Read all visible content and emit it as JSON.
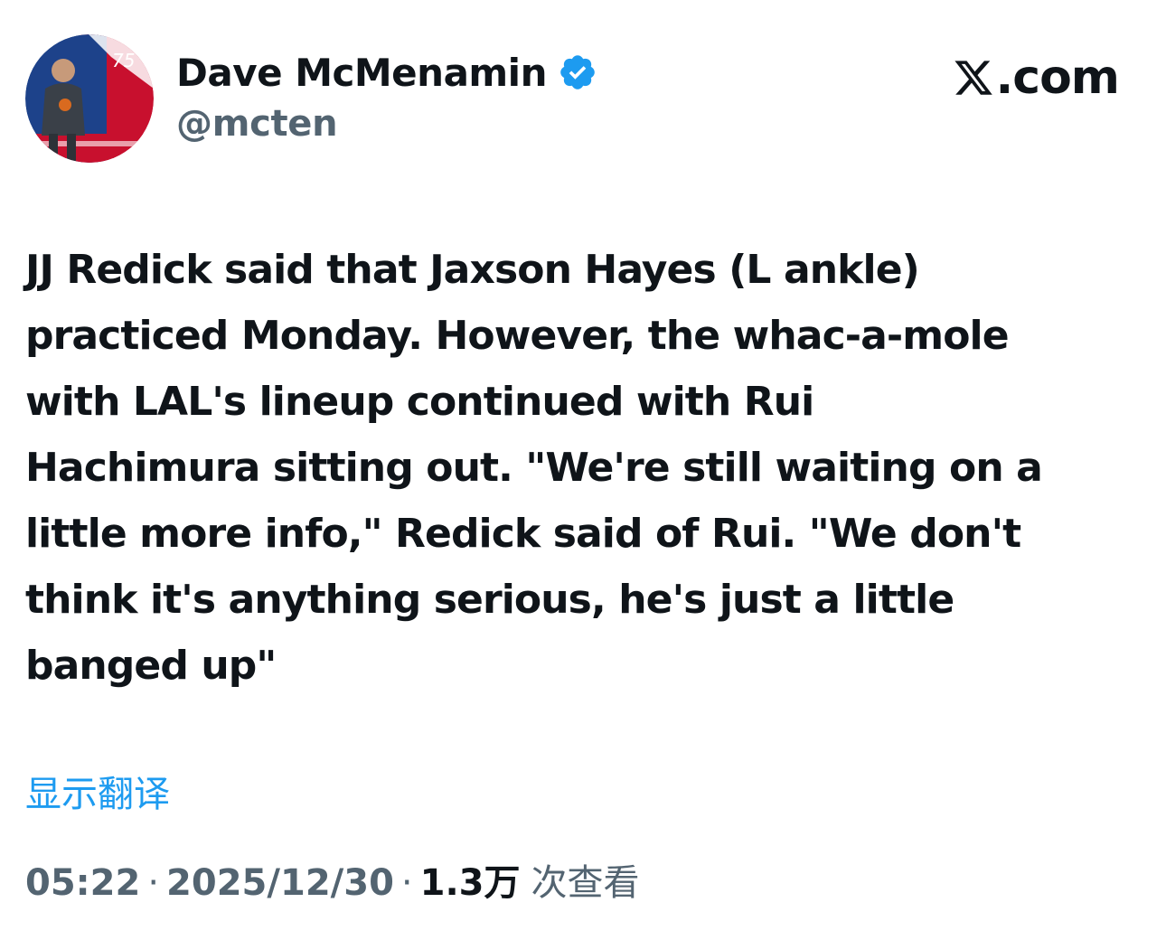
{
  "header": {
    "display_name": "Dave McMenamin",
    "handle": "@mcten",
    "verified": true,
    "verified_icon": "verified-badge-icon",
    "avatar_icon": "avatar"
  },
  "brand": {
    "logo_icon": "x-logo-icon",
    "text": ".com"
  },
  "tweet": {
    "text": "JJ Redick said that Jaxson Hayes (L ankle)\npracticed Monday. However, the whac-a-mole\nwith LAL's lineup continued with Rui\nHachimura sitting out. \"We're still waiting on a\nlittle more info,\" Redick said of Rui. \"We don't\nthink it's anything serious, he's just a little\nbanged up\""
  },
  "translate": {
    "label": "显示翻译"
  },
  "meta": {
    "time": "05:22",
    "separator": "·",
    "date": "2025/12/30",
    "views_count": "1.3万",
    "views_label": "次查看"
  },
  "colors": {
    "text": "#0f1419",
    "secondary": "#536471",
    "link": "#1d9bf0",
    "verified": "#1d9bf0"
  }
}
